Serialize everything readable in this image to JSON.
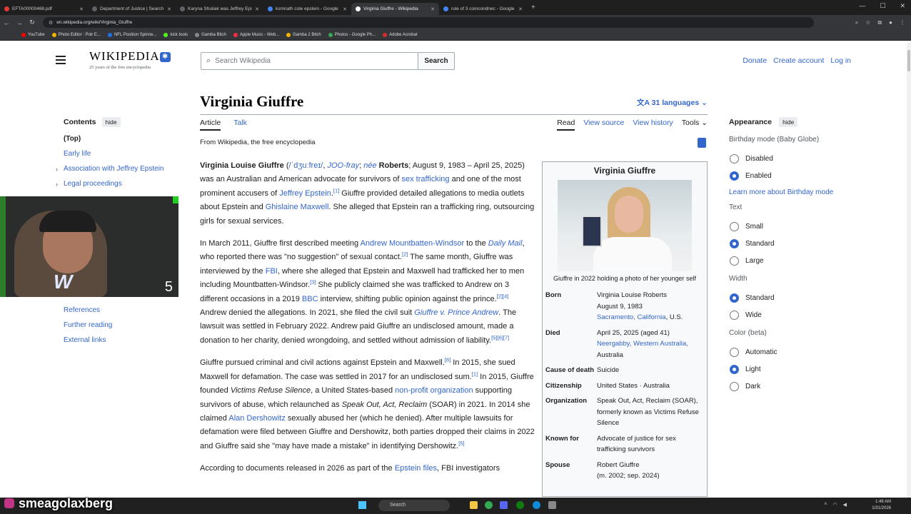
{
  "browser": {
    "tabs": [
      {
        "title": "EFTA00000468.pdf",
        "color": "#e53935"
      },
      {
        "title": "Department of Justice | Search",
        "color": "#5f6368"
      },
      {
        "title": "Karyna Shuliak was Jeffrey Epst…",
        "color": "#5f6368"
      },
      {
        "title": "ksmnath cole epstein - Google",
        "color": "#4285f4"
      },
      {
        "title": "Virginia Giuffre - Wikipedia",
        "color": "#ffffff",
        "active": true
      },
      {
        "title": "rule of 3 coincondnec - Google",
        "color": "#4285f4"
      }
    ],
    "url": "en.wikipedia.org/wiki/Virginia_Giuffre",
    "bookmarks": [
      {
        "label": "YouTube",
        "color": "#ff0000"
      },
      {
        "label": "Photo Editor : Polr E...",
        "color": "#f4b400"
      },
      {
        "label": "NFL Position Spinne...",
        "color": "#1a73e8"
      },
      {
        "label": "kick tools",
        "color": "#53fc18"
      },
      {
        "label": "Gamba Bitch",
        "color": "#888888"
      },
      {
        "label": "Apple Music - Web...",
        "color": "#fa2d48"
      },
      {
        "label": "Gamba 2 Bitch",
        "color": "#f4b400"
      },
      {
        "label": "Photos - Google Ph...",
        "color": "#34a853"
      },
      {
        "label": "Adobe Acrobat",
        "color": "#d32f2f"
      }
    ]
  },
  "header": {
    "logo_text": "WIKIPEDIA",
    "tagline": "25 years of the free encyclopedia",
    "search_placeholder": "Search Wikipedia",
    "search_button": "Search",
    "donate": "Donate",
    "create_account": "Create account",
    "login": "Log in"
  },
  "page": {
    "title": "Virginia Giuffre",
    "languages": "31 languages",
    "tab_article": "Article",
    "tab_talk": "Talk",
    "read": "Read",
    "view_source": "View source",
    "view_history": "View history",
    "tools": "Tools",
    "from": "From Wikipedia, the free encyclopedia"
  },
  "toc": {
    "title": "Contents",
    "hide": "hide",
    "items": [
      "(Top)",
      "Early life",
      "Association with Jeffrey Epstein",
      "Legal proceedings",
      "References",
      "Further reading",
      "External links"
    ]
  },
  "overlay": {
    "counter": "5",
    "handle": "smeagolaxberg"
  },
  "infobox": {
    "title": "Virginia Giuffre",
    "caption": "Giuffre in 2022 holding a photo of her younger self",
    "born_label": "Born",
    "born_name": "Virginia Louise Roberts",
    "born_date": "August 9, 1983",
    "born_place": "Sacramento, California",
    "born_country": ", U.S.",
    "died_label": "Died",
    "died_date": "April 25, 2025 (aged 41)",
    "died_place": "Neergabby, Western Australia,",
    "died_country": "Australia",
    "cause_label": "Cause of death",
    "cause": "Suicide",
    "citizenship_label": "Citizenship",
    "citizenship": "United States · Australia",
    "org_label": "Organization",
    "org": "Speak Out, Act, Reclaim (SOAR), formerly known as Victims Refuse Silence",
    "known_label": "Known for",
    "known": "Advocate of justice for sex trafficking survivors",
    "spouse_label": "Spouse",
    "spouse": "Robert Giuffre",
    "spouse_years": "(m. 2002; sep. 2024)"
  },
  "appearance": {
    "title": "Appearance",
    "hide": "hide",
    "birthday_label": "Birthday mode (Baby Globe)",
    "disabled": "Disabled",
    "enabled": "Enabled",
    "learn_more": "Learn more about Birthday mode",
    "text_label": "Text",
    "small": "Small",
    "standard": "Standard",
    "large": "Large",
    "width_label": "Width",
    "width_standard": "Standard",
    "wide": "Wide",
    "color_label": "Color (beta)",
    "automatic": "Automatic",
    "light": "Light",
    "dark": "Dark"
  },
  "taskbar": {
    "search": "Search",
    "time": "1:48 AM",
    "date": "1/31/2026"
  }
}
